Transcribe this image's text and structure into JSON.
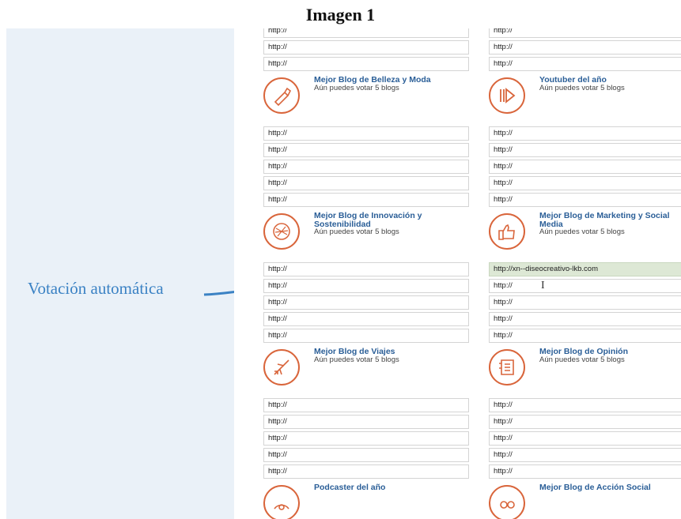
{
  "heading": "Imagen 1",
  "annotation": "Votación automática",
  "colors": {
    "accent": "#d9653b",
    "title": "#2a5e97",
    "annotation": "#3b82c4",
    "filled": "#dde8d5",
    "sidebar": "#eaf1f8"
  },
  "left_column": {
    "top_fields": [
      "http://",
      "http://",
      "http://"
    ],
    "categories": [
      {
        "title": "Mejor Blog de Belleza y Moda",
        "subtitle": "Aún puedes votar 5 blogs",
        "icon": "lipstick-icon",
        "fields": [
          "http://",
          "http://",
          "http://",
          "http://",
          "http://"
        ]
      },
      {
        "title": "Mejor Blog de Innovación y Sostenibilidad",
        "subtitle": "Aún puedes votar 5 blogs",
        "icon": "globe-leaf-icon",
        "fields": [
          "http://",
          "http://",
          "http://",
          "http://",
          "http://"
        ]
      },
      {
        "title": "Mejor Blog de Viajes",
        "subtitle": "Aún puedes votar 5 blogs",
        "icon": "airplane-icon",
        "fields": [
          "http://",
          "http://",
          "http://",
          "http://",
          "http://"
        ]
      },
      {
        "title": "Podcaster del año",
        "subtitle": "",
        "icon": "microphone-icon",
        "fields": []
      }
    ]
  },
  "right_column": {
    "top_fields": [
      "http://",
      "http://",
      "http://"
    ],
    "categories": [
      {
        "title": "Youtuber del año",
        "subtitle": "Aún puedes votar 5 blogs",
        "icon": "play-icon",
        "fields": [
          "http://",
          "http://",
          "http://",
          "http://",
          "http://"
        ]
      },
      {
        "title": "Mejor Blog de Marketing y Social Media",
        "subtitle": "Aún puedes votar 5 blogs",
        "icon": "thumbs-up-icon",
        "fields": [
          "http://xn--diseocreativo-lkb.com",
          "http://",
          "http://",
          "http://",
          "http://"
        ]
      },
      {
        "title": "Mejor Blog de Opinión",
        "subtitle": "Aún puedes votar 5 blogs",
        "icon": "document-icon",
        "fields": [
          "http://",
          "http://",
          "http://",
          "http://",
          "http://"
        ]
      },
      {
        "title": "Mejor Blog de Acción Social",
        "subtitle": "",
        "icon": "people-icon",
        "fields": []
      }
    ]
  }
}
